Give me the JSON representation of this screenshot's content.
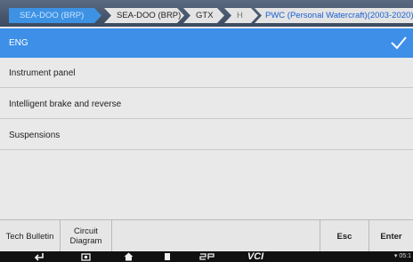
{
  "breadcrumbs": [
    "SEA-DOO (BRP)",
    "SEA-DOO (BRP)",
    "GTX",
    "H",
    "PWC (Personal Watercraft)(2003-2020)"
  ],
  "menu": {
    "items": [
      "ENG",
      "Instrument panel",
      "Intelligent brake and reverse",
      "Suspensions"
    ],
    "selected_index": 0
  },
  "toolbar": {
    "tech_bulletin": "Tech Bulletin",
    "circuit_diagram_line1": "Circuit",
    "circuit_diagram_line2": "Diagram",
    "esc": "Esc",
    "enter": "Enter"
  },
  "navbar": {
    "vci_label": "VCI",
    "status_time": "05:1"
  },
  "colors": {
    "accent": "#3d8fe8",
    "list_bg": "#e9e9e9",
    "nav_bg": "#111111"
  }
}
